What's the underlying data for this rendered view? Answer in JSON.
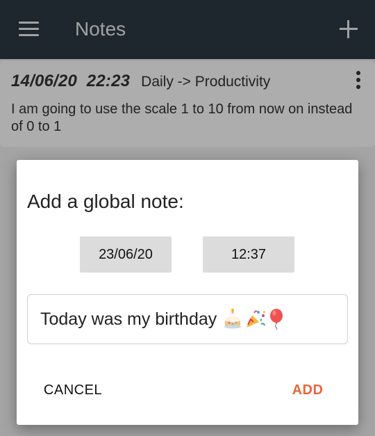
{
  "appbar": {
    "title": "Notes",
    "menu_icon": "hamburger-menu-icon",
    "add_icon": "plus-icon"
  },
  "note": {
    "date": "14/06/20",
    "time": "22:23",
    "track": "Daily -> Productivity",
    "text": "I am going to use the scale 1 to 10 from now on instead of 0 to 1",
    "more_icon": "more-vert-icon"
  },
  "dialog": {
    "title": "Add a global note:",
    "date": "23/06/20",
    "time": "12:37",
    "input_value": "Today was my birthday",
    "input_emojis": [
      "birthday-cake-icon",
      "party-popper-icon",
      "balloon-icon"
    ],
    "cancel_label": "CANCEL",
    "add_label": "ADD"
  },
  "colors": {
    "appbar": "#2b3a43",
    "accent": "#e8673a",
    "picker_bg": "#dcdcdc"
  }
}
